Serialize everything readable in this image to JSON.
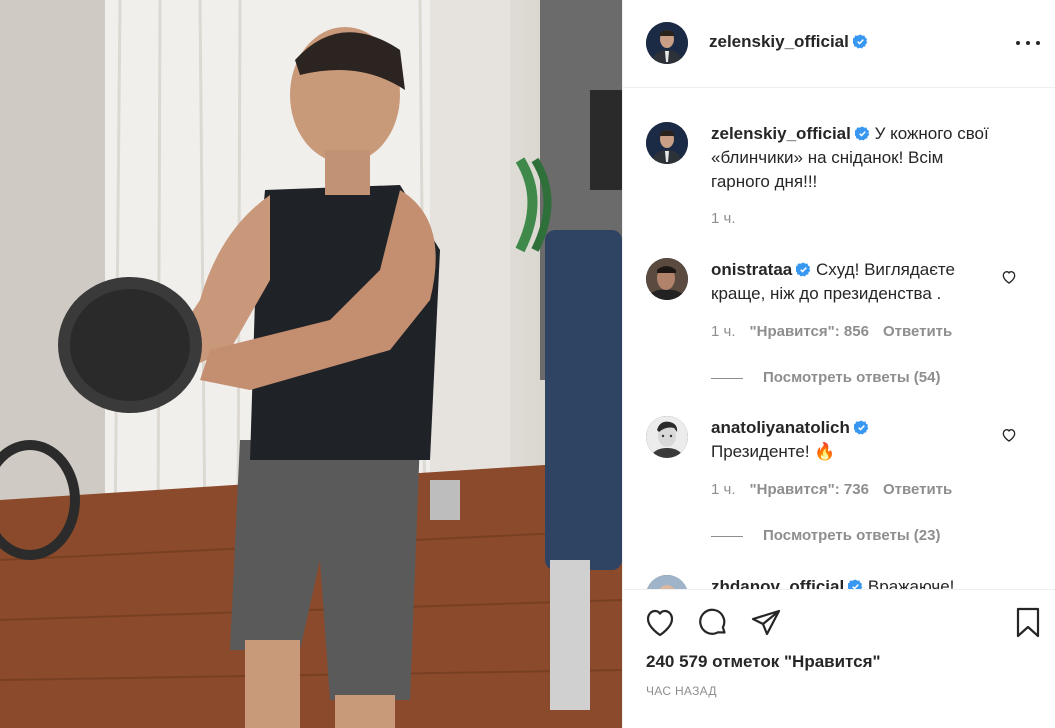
{
  "post": {
    "username": "zelenskiy_official",
    "caption": "У кожного свої «блинчики» на сніданок! Всім гарного дня!!!",
    "caption_time": "1 ч."
  },
  "comments": [
    {
      "username": "onistrataa",
      "text": "Схуд! Виглядаєте краще, ніж до президенства .",
      "time": "1 ч.",
      "likes": "\"Нравится\": 856",
      "reply": "Ответить",
      "view_replies": "Посмотреть ответы (54)"
    },
    {
      "username": "anatoliyanatolich",
      "text": "Президенте! 🔥",
      "time": "1 ч.",
      "likes": "\"Нравится\": 736",
      "reply": "Ответить",
      "view_replies": "Посмотреть ответы (23)"
    },
    {
      "username": "zhdanov_official",
      "text": "Вражаюче!"
    }
  ],
  "footer": {
    "likes": "240 579 отметок \"Нравится\"",
    "timestamp": "ЧАС НАЗАД"
  },
  "icons": {
    "verified": "verified-badge-icon",
    "more": "more-options-icon",
    "like": "heart-icon",
    "comment": "comment-icon",
    "share": "share-icon",
    "save": "bookmark-icon"
  },
  "colors": {
    "verified_blue": "#3897f0",
    "text": "#262626",
    "secondary": "#8e8e8e",
    "border": "#efefef"
  }
}
